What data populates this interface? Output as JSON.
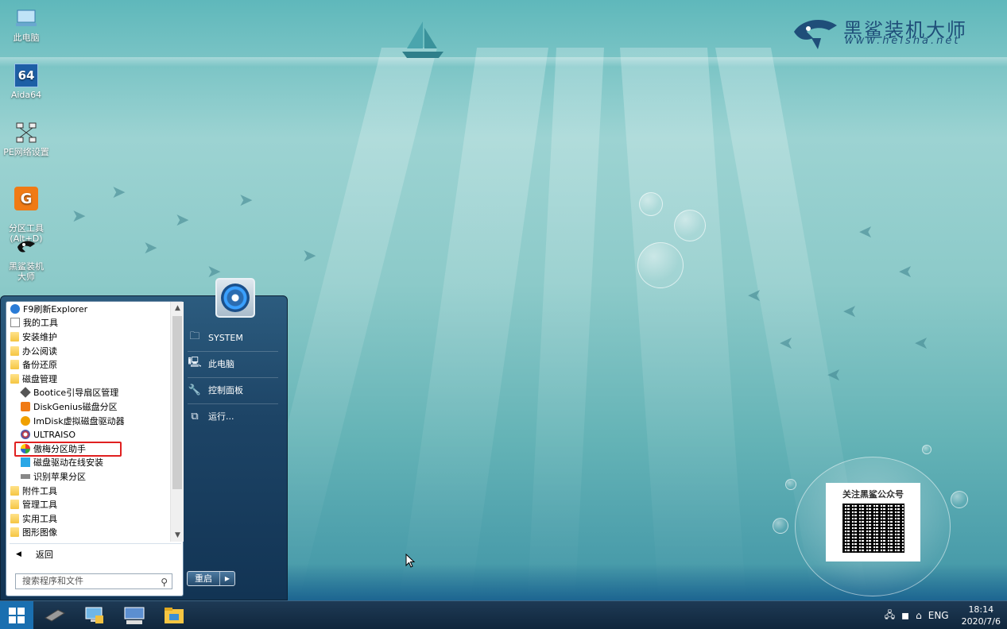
{
  "brand": {
    "name": "黑鲨装机大师",
    "url": "www.heisha.net"
  },
  "desktop_icons": [
    {
      "label": "此电脑"
    },
    {
      "label": "Aida64",
      "badge": "64"
    },
    {
      "label": "PE网络设置"
    },
    {
      "label": "分区工具\n(Alt+D)"
    },
    {
      "label": "黑鲨装机大师"
    }
  ],
  "qr": {
    "title": "关注黑鲨公众号"
  },
  "start_menu": {
    "programs": [
      {
        "label": "F9刷新Explorer",
        "icon": "refresh-icon",
        "sub": false
      },
      {
        "label": "我的工具",
        "icon": "document-icon",
        "sub": false
      },
      {
        "label": "安装维护",
        "icon": "folder-icon",
        "sub": false
      },
      {
        "label": "办公阅读",
        "icon": "folder-icon",
        "sub": false
      },
      {
        "label": "备份还原",
        "icon": "folder-icon",
        "sub": false
      },
      {
        "label": "磁盘管理",
        "icon": "folder-icon",
        "sub": false
      },
      {
        "label": "Bootice引导扇区管理",
        "icon": "bootice-icon",
        "sub": true
      },
      {
        "label": "DiskGenius磁盘分区",
        "icon": "diskgenius-icon",
        "sub": true
      },
      {
        "label": "ImDisk虚拟磁盘驱动器",
        "icon": "imdisk-icon",
        "sub": true
      },
      {
        "label": "ULTRAISO",
        "icon": "ultraiso-icon",
        "sub": true
      },
      {
        "label": "傲梅分区助手",
        "icon": "aomei-icon",
        "sub": true
      },
      {
        "label": "磁盘驱动在线安装",
        "icon": "driver-icon",
        "sub": true
      },
      {
        "label": "识别苹果分区",
        "icon": "apple-partition-icon",
        "sub": true
      },
      {
        "label": "附件工具",
        "icon": "folder-icon",
        "sub": false
      },
      {
        "label": "管理工具",
        "icon": "folder-icon",
        "sub": false
      },
      {
        "label": "实用工具",
        "icon": "folder-icon",
        "sub": false
      },
      {
        "label": "图形图像",
        "icon": "folder-icon",
        "sub": false
      }
    ],
    "back_label": "返回",
    "search_placeholder": "搜索程序和文件",
    "right_items": [
      {
        "label": "SYSTEM",
        "icon": "user-folder-icon"
      },
      {
        "label": "此电脑",
        "icon": "computer-icon"
      },
      {
        "label": "控制面板",
        "icon": "wrench-icon"
      },
      {
        "label": "运行...",
        "icon": "run-icon"
      }
    ],
    "restart_label": "重启"
  },
  "taskbar": {
    "pinned": [
      "disk-tool-icon",
      "computer-network-icon",
      "keyboard-icon",
      "file-explorer-icon"
    ],
    "tray": {
      "lang": "ENG",
      "time": "18:14",
      "date": "2020/7/6"
    }
  }
}
